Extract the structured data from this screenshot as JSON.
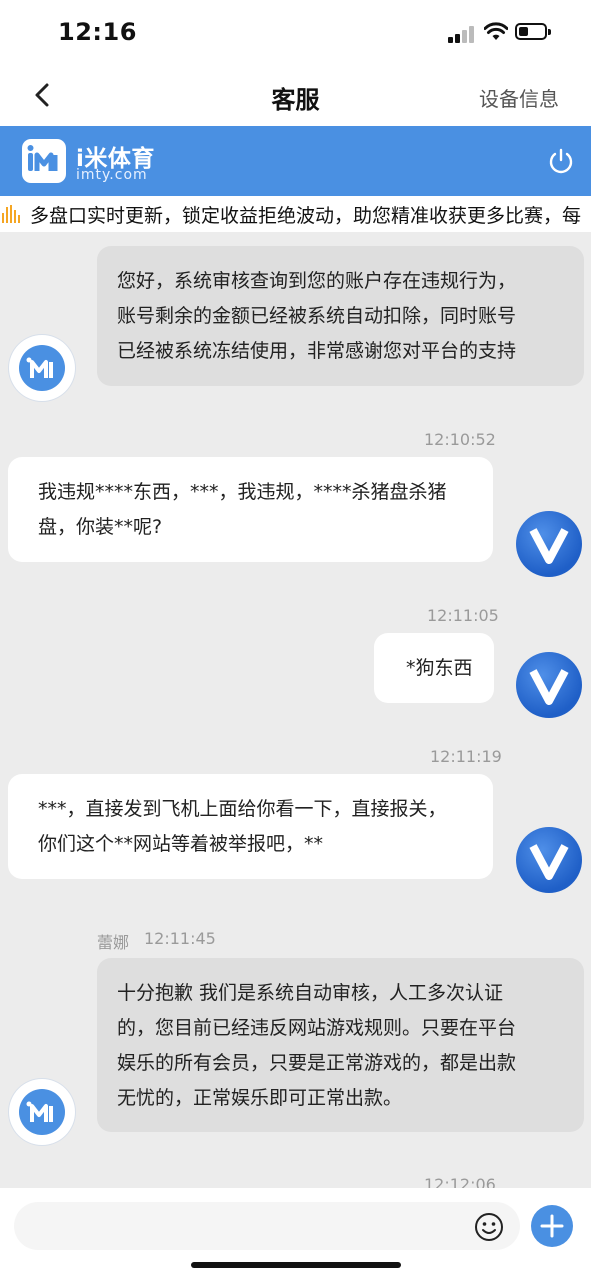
{
  "status": {
    "time": "12:16"
  },
  "nav": {
    "back_icon": "chevron-left-icon",
    "title": "客服",
    "device_info": "设备信息"
  },
  "brand": {
    "name": "i米体育",
    "domain": "imty.com",
    "logo_text": "iM",
    "accent": "#4a90e2"
  },
  "marquee": {
    "text": "多盘口实时更新，锁定收益拒绝波动，助您精准收获更多比赛，每"
  },
  "chat": {
    "msg1": {
      "lines": [
        "您好，系统审核查询到您的账户存在违规行为，",
        "账号剩余的金额已经被系统自动扣除，同时账号",
        "已经被系统冻结使用，非常感谢您对平台的支持"
      ]
    },
    "msg2": {
      "time": "12:10:52",
      "lines": [
        "我违规****东西，***，我违规，****杀猪盘杀猪",
        "盘，你装**呢?"
      ]
    },
    "msg3": {
      "time": "12:11:05",
      "lines": [
        "*狗东西"
      ]
    },
    "msg4": {
      "time": "12:11:19",
      "lines": [
        "***，直接发到飞机上面给你看一下，直接报关，",
        "你们这个**网站等着被举报吧，**"
      ]
    },
    "msg5": {
      "sender": "蕾娜",
      "time": "12:11:45",
      "lines": [
        "十分抱歉 我们是系统自动审核，人工多次认证",
        "的，您目前已经违反网站游戏规则。只要在平台",
        "娱乐的所有会员，只要是正常游戏的，都是出款",
        "无忧的，正常娱乐即可正常出款。"
      ]
    },
    "next_time": "12:12:06",
    "user_avatar_letter": "V"
  },
  "input": {
    "placeholder": "",
    "emoji_icon": "smiley-icon",
    "plus_icon": "plus-icon"
  }
}
